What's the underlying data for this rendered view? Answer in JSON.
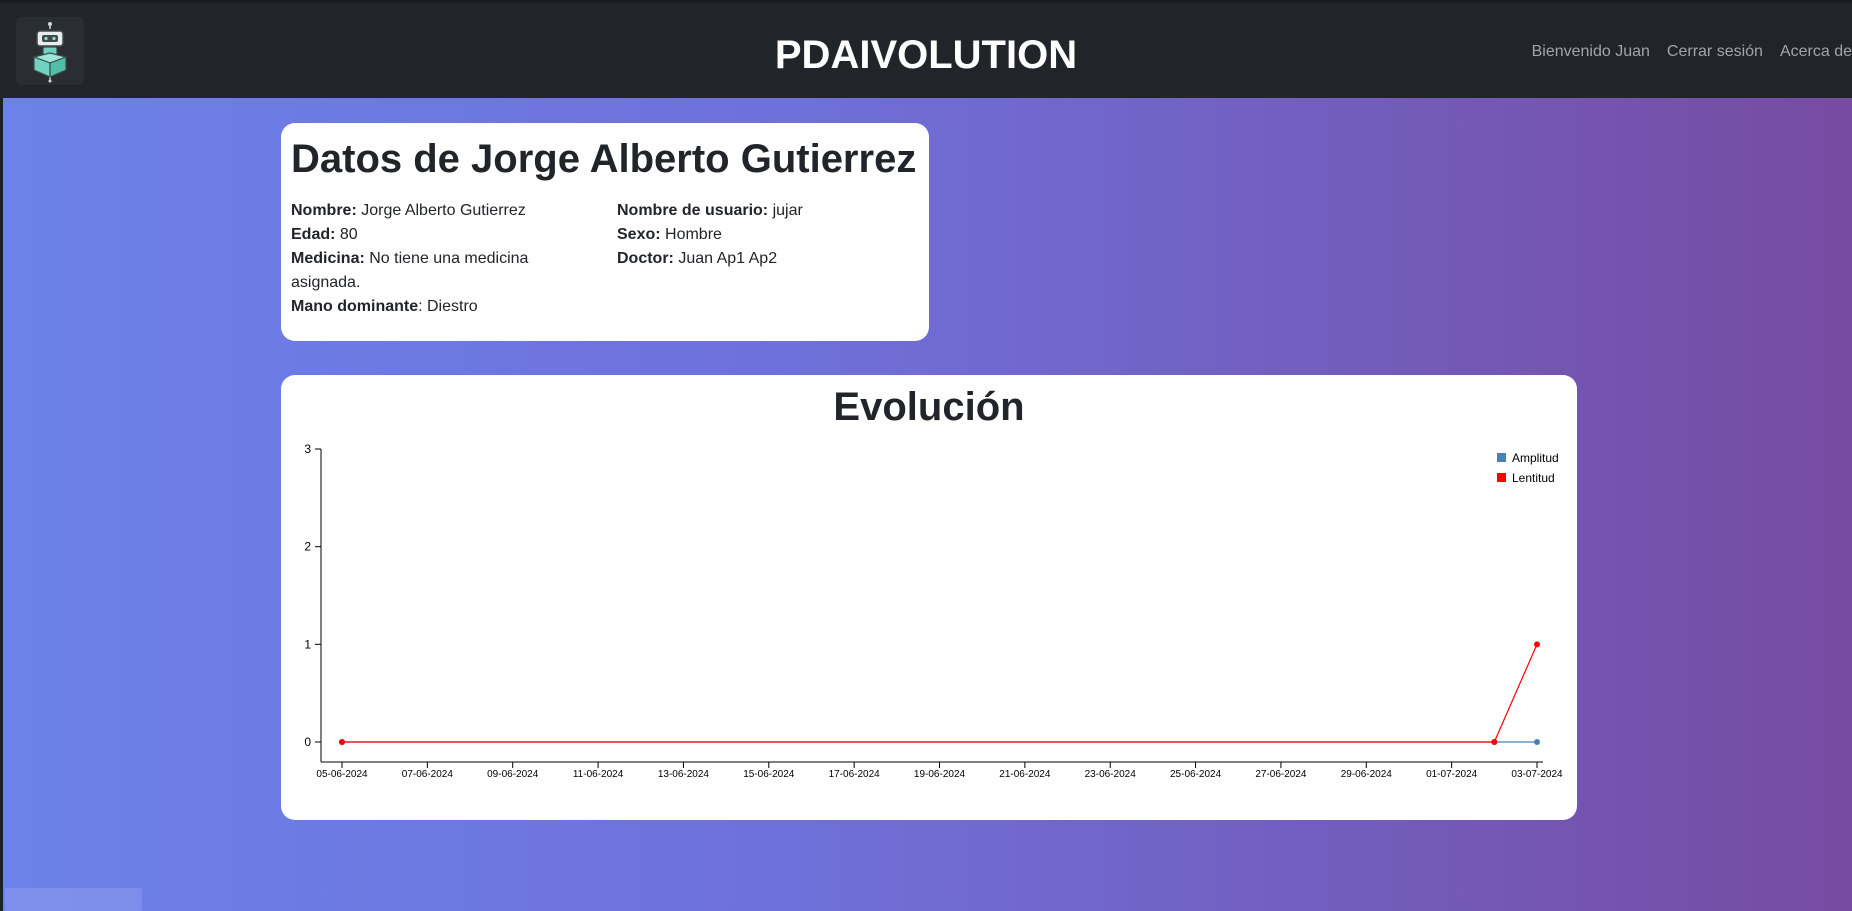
{
  "header": {
    "brand": "PDAIVOLUTION",
    "nav": {
      "welcome": "Bienvenido Juan",
      "logout": "Cerrar sesión",
      "about": "Acerca de"
    }
  },
  "patient": {
    "title": "Datos de Jorge Alberto Gutierrez",
    "fields": {
      "name_label": "Nombre:",
      "name_value": " Jorge Alberto Gutierrez",
      "age_label": "Edad:",
      "age_value": " 80",
      "medicine_label": "Medicina:",
      "medicine_value": " No tiene una medicina asignada.",
      "hand_label": "Mano dominante",
      "hand_value": ": Diestro",
      "username_label": "Nombre de usuario:",
      "username_value": " jujar",
      "sex_label": "Sexo:",
      "sex_value": " Hombre",
      "doctor_label": "Doctor:",
      "doctor_value": " Juan Ap1 Ap2"
    }
  },
  "evolution": {
    "title": "Evolución"
  },
  "chart_data": {
    "type": "line",
    "ylim": [
      0,
      3
    ],
    "y_ticks": [
      0,
      1,
      2,
      3
    ],
    "x_ticks": [
      "05-06-2024",
      "07-06-2024",
      "09-06-2024",
      "11-06-2024",
      "13-06-2024",
      "15-06-2024",
      "17-06-2024",
      "19-06-2024",
      "21-06-2024",
      "23-06-2024",
      "25-06-2024",
      "27-06-2024",
      "29-06-2024",
      "01-07-2024",
      "03-07-2024"
    ],
    "x_range": [
      "05-06-2024",
      "03-07-2024"
    ],
    "legend_position": "top-right",
    "series": [
      {
        "name": "Amplitud",
        "color": "#4682b4",
        "points": [
          {
            "x": "05-06-2024",
            "y": 0
          },
          {
            "x": "02-07-2024",
            "y": 0
          },
          {
            "x": "03-07-2024",
            "y": 0
          }
        ]
      },
      {
        "name": "Lentitud",
        "color": "#ff0000",
        "points": [
          {
            "x": "05-06-2024",
            "y": 0
          },
          {
            "x": "02-07-2024",
            "y": 0
          },
          {
            "x": "03-07-2024",
            "y": 1
          }
        ]
      }
    ]
  }
}
